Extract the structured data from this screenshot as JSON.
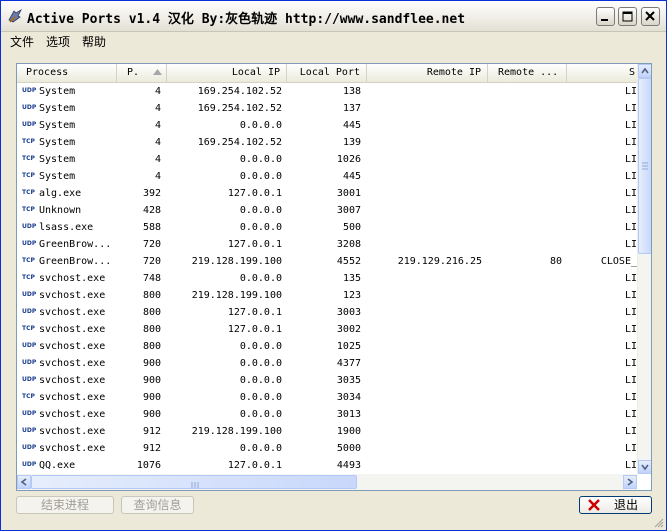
{
  "window": {
    "title": "Active Ports v1.4 汉化 By:灰色轨迹 http://www.sandflee.net"
  },
  "menu": {
    "items": [
      "文件",
      "选项",
      "帮助"
    ]
  },
  "table": {
    "columns": [
      "Process",
      "P.",
      "Local IP",
      "Local Port",
      "Remote IP",
      "Remote ...",
      "S"
    ],
    "rows": [
      {
        "proto": "UDP",
        "process": "System",
        "pid": "4",
        "local_ip": "169.254.102.52",
        "local_port": "138",
        "remote_ip": "",
        "remote_port": "",
        "state": "LI"
      },
      {
        "proto": "UDP",
        "process": "System",
        "pid": "4",
        "local_ip": "169.254.102.52",
        "local_port": "137",
        "remote_ip": "",
        "remote_port": "",
        "state": "LI"
      },
      {
        "proto": "UDP",
        "process": "System",
        "pid": "4",
        "local_ip": "0.0.0.0",
        "local_port": "445",
        "remote_ip": "",
        "remote_port": "",
        "state": "LI"
      },
      {
        "proto": "TCP",
        "process": "System",
        "pid": "4",
        "local_ip": "169.254.102.52",
        "local_port": "139",
        "remote_ip": "",
        "remote_port": "",
        "state": "LI"
      },
      {
        "proto": "TCP",
        "process": "System",
        "pid": "4",
        "local_ip": "0.0.0.0",
        "local_port": "1026",
        "remote_ip": "",
        "remote_port": "",
        "state": "LI"
      },
      {
        "proto": "TCP",
        "process": "System",
        "pid": "4",
        "local_ip": "0.0.0.0",
        "local_port": "445",
        "remote_ip": "",
        "remote_port": "",
        "state": "LI"
      },
      {
        "proto": "TCP",
        "process": "alg.exe",
        "pid": "392",
        "local_ip": "127.0.0.1",
        "local_port": "3001",
        "remote_ip": "",
        "remote_port": "",
        "state": "LI"
      },
      {
        "proto": "TCP",
        "process": "Unknown",
        "pid": "428",
        "local_ip": "0.0.0.0",
        "local_port": "3007",
        "remote_ip": "",
        "remote_port": "",
        "state": "LI"
      },
      {
        "proto": "UDP",
        "process": "lsass.exe",
        "pid": "588",
        "local_ip": "0.0.0.0",
        "local_port": "500",
        "remote_ip": "",
        "remote_port": "",
        "state": "LI"
      },
      {
        "proto": "UDP",
        "process": "GreenBrow...",
        "pid": "720",
        "local_ip": "127.0.0.1",
        "local_port": "3208",
        "remote_ip": "",
        "remote_port": "",
        "state": "LI"
      },
      {
        "proto": "TCP",
        "process": "GreenBrow...",
        "pid": "720",
        "local_ip": "219.128.199.100",
        "local_port": "4552",
        "remote_ip": "219.129.216.25",
        "remote_port": "80",
        "state": "CLOSE_"
      },
      {
        "proto": "TCP",
        "process": "svchost.exe",
        "pid": "748",
        "local_ip": "0.0.0.0",
        "local_port": "135",
        "remote_ip": "",
        "remote_port": "",
        "state": "LI"
      },
      {
        "proto": "UDP",
        "process": "svchost.exe",
        "pid": "800",
        "local_ip": "219.128.199.100",
        "local_port": "123",
        "remote_ip": "",
        "remote_port": "",
        "state": "LI"
      },
      {
        "proto": "UDP",
        "process": "svchost.exe",
        "pid": "800",
        "local_ip": "127.0.0.1",
        "local_port": "3003",
        "remote_ip": "",
        "remote_port": "",
        "state": "LI"
      },
      {
        "proto": "TCP",
        "process": "svchost.exe",
        "pid": "800",
        "local_ip": "127.0.0.1",
        "local_port": "3002",
        "remote_ip": "",
        "remote_port": "",
        "state": "LI"
      },
      {
        "proto": "UDP",
        "process": "svchost.exe",
        "pid": "800",
        "local_ip": "0.0.0.0",
        "local_port": "1025",
        "remote_ip": "",
        "remote_port": "",
        "state": "LI"
      },
      {
        "proto": "UDP",
        "process": "svchost.exe",
        "pid": "900",
        "local_ip": "0.0.0.0",
        "local_port": "4377",
        "remote_ip": "",
        "remote_port": "",
        "state": "LI"
      },
      {
        "proto": "UDP",
        "process": "svchost.exe",
        "pid": "900",
        "local_ip": "0.0.0.0",
        "local_port": "3035",
        "remote_ip": "",
        "remote_port": "",
        "state": "LI"
      },
      {
        "proto": "TCP",
        "process": "svchost.exe",
        "pid": "900",
        "local_ip": "0.0.0.0",
        "local_port": "3034",
        "remote_ip": "",
        "remote_port": "",
        "state": "LI"
      },
      {
        "proto": "UDP",
        "process": "svchost.exe",
        "pid": "900",
        "local_ip": "0.0.0.0",
        "local_port": "3013",
        "remote_ip": "",
        "remote_port": "",
        "state": "LI"
      },
      {
        "proto": "UDP",
        "process": "svchost.exe",
        "pid": "912",
        "local_ip": "219.128.199.100",
        "local_port": "1900",
        "remote_ip": "",
        "remote_port": "",
        "state": "LI"
      },
      {
        "proto": "UDP",
        "process": "svchost.exe",
        "pid": "912",
        "local_ip": "0.0.0.0",
        "local_port": "5000",
        "remote_ip": "",
        "remote_port": "",
        "state": "LI"
      },
      {
        "proto": "UDP",
        "process": "QQ.exe",
        "pid": "1076",
        "local_ip": "127.0.0.1",
        "local_port": "4493",
        "remote_ip": "",
        "remote_port": "",
        "state": "LI"
      }
    ]
  },
  "buttons": {
    "end_process": "结束进程",
    "query_info": "查询信息",
    "exit": "退出"
  },
  "colors": {
    "accent": "#0831D9",
    "exit_icon": "#CC0000"
  }
}
